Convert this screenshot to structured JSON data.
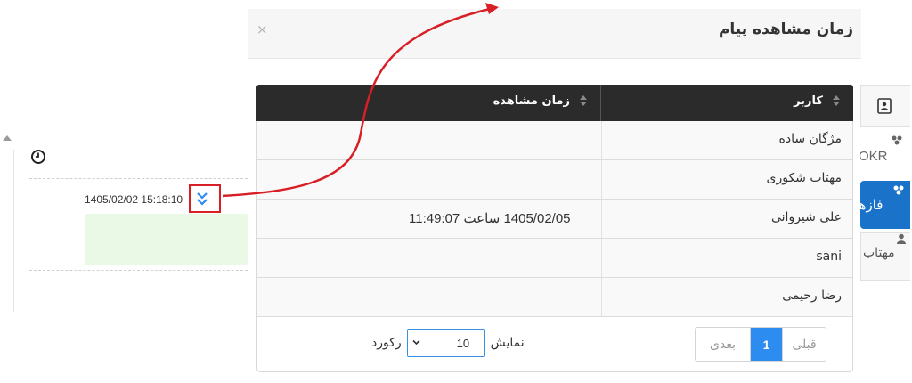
{
  "modal": {
    "title": "زمان مشاهده پیام",
    "close_label": "×"
  },
  "table": {
    "columns": [
      "کاربر",
      "زمان مشاهده"
    ],
    "rows": [
      {
        "user": "مژگان ساده",
        "seen_time": ""
      },
      {
        "user": "مهتاب شکوری",
        "seen_time": ""
      },
      {
        "user": "علی شیروانی",
        "seen_time": "1405/02/05 ساعت 11:49:07"
      },
      {
        "user": "sani",
        "seen_time": ""
      },
      {
        "user": "رضا رحیمی",
        "seen_time": ""
      }
    ]
  },
  "pagination": {
    "prev_label": "قبلی",
    "current_page": "1",
    "next_label": "بعدی"
  },
  "page_length": {
    "show_label": "نمایش",
    "value": "10",
    "records_label": "رکورد"
  },
  "chat": {
    "message_time": "1405/02/02 15:18:10",
    "icons": [
      "clock-icon",
      "double-check-icon"
    ]
  },
  "side_tabs": {
    "okr_label": "OKR",
    "phases_label": "فازها",
    "person_label": "مهتاب"
  },
  "colors": {
    "header_dark": "#2b2b2b",
    "primary": "#2d8cf0",
    "annotation_red": "#d81f26",
    "bubble_green": "#eaf9e6"
  }
}
